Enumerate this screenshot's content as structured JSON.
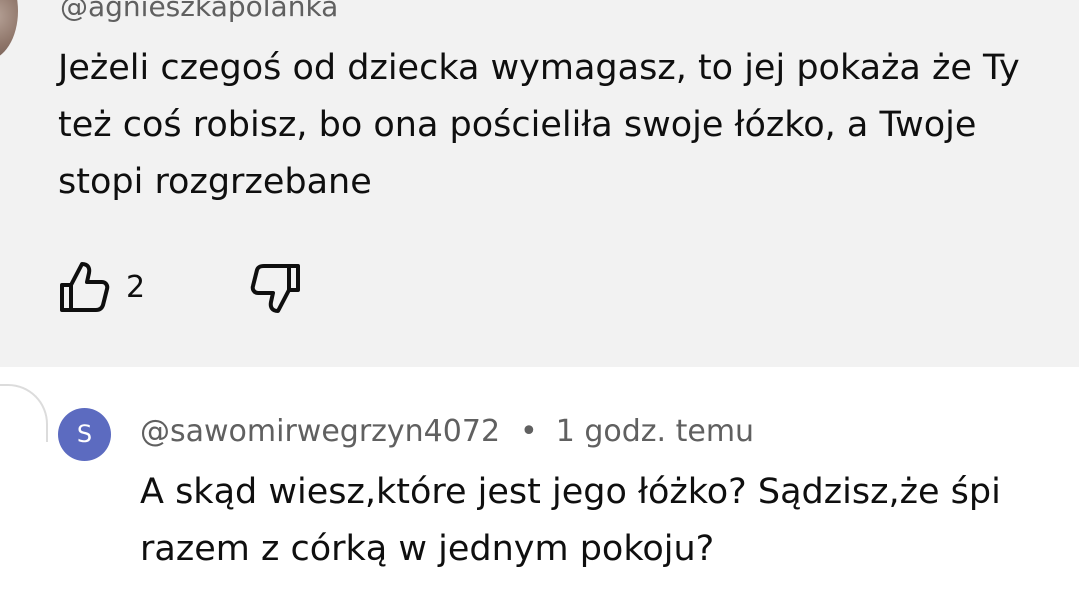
{
  "parent_comment": {
    "author": "@agnieszkapolanka",
    "text": "Jeżeli czegoś od dziecka wymagasz, to jej pokaża że Ty też coś robisz, bo ona pościeliła swoje łózko, a Twoje stopi rozgrzebane",
    "like_count": "2",
    "like_icon": "thumbs-up-icon",
    "dislike_icon": "thumbs-down-icon",
    "background_color": "#f2f2f2"
  },
  "reply": {
    "avatar_letter": "S",
    "avatar_color": "#5c6bc0",
    "author": "@sawomirwegrzyn4072",
    "separator": "•",
    "time": "1 godz. temu",
    "text": "A skąd wiesz,które jest jego łóżko? Sądzisz,że śpi razem z córką w jednym pokoju?"
  }
}
